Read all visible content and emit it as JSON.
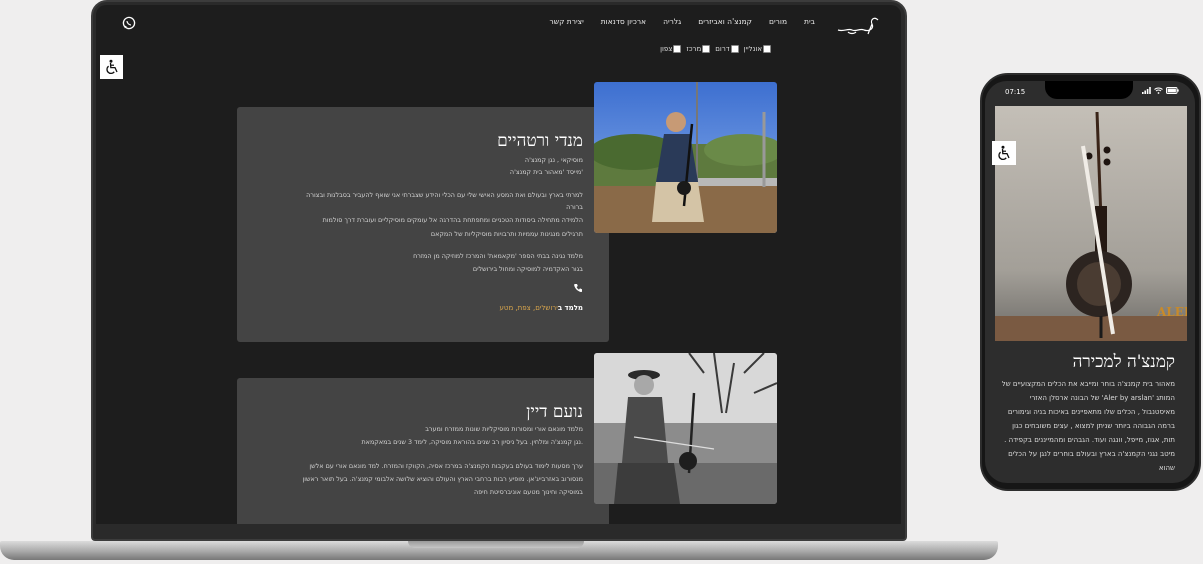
{
  "site": {
    "nav": [
      "בית",
      "מורים",
      "קמנצ'ה ואביזרים",
      "גלריה",
      "ארכיון סדנאות",
      "יצירת קשר"
    ],
    "filters": [
      "אונליין",
      "דרום",
      "מרכז",
      "צפון"
    ]
  },
  "teachers": [
    {
      "name": "מנדי ורטהיים",
      "lines": [
        "מוסיקאי  , נגן קמנצ'ה",
        "מייסד 'מאהור בית קמנצ'ה'",
        "",
        "למרתי בארץ ובעולם ואת המסע האישי שלי עם הכלי והידע שצברתי אני שואף להעביר בסבלנות ובצורה",
        "ברורה",
        "הלמידה מתחילה ביסודות הטכניים ומתפתחת בהדרגה אל עומקים מוסיקליים ועוברת דרך סולמות",
        "תרגילים מנגינות עממיות ותרבויות מוסיקליות של המקאם",
        "",
        "מלמד נגינה בבתי הספר 'מקאמאת' והמרכז למוזיקה מן המזרח",
        "בגור האקדמיה למוסיקה ומחול בירושלים"
      ],
      "location_label": "מלמד ב",
      "location_value": "ירושלים, צפת, מטע"
    },
    {
      "name": "נועם דיין",
      "lines": [
        "מלמד מונאם אורי ומסורות מוסיקליות שונות ממזרח ומערב",
        "נגן קמנצ'ה ומלחין. בעל ניסיון רב שנים בהוראת מוסיקה, לימד 3 שנים במאקמאת.",
        "",
        "ערך מסעות לימוד בעולם בעקבות הקמנצ'ה במרכז אסיה, הקווקז והמזרח. למד מונאם אורי עם אלשן",
        "מנסורוב באזרבייג'אן. מופיע רבות ברחבי הארץ והעולם והוציא שלושה אלבומי קמנצ'ה. בעל תואר ראשון",
        "במוסיקה וחינוך מטעם אוניברסיטת חיפה"
      ]
    }
  ],
  "mobile": {
    "status_time": "07:15",
    "title": "קמנצ'ה למכירה",
    "paragraph": "מאהור בית קמנצ'ה בוחר ומייבא את הכלים המקצועיים של המותג 'Aler by arslan' של הבונה ארסלן האזרי מאיסטנבול , הכלים שלו מתאפיינים באיכות בניה וגימורים ברמה הגבוהה ביותר שניתן למצוא , עצים משובחים כגון תות, אגוז, מייפל, וונגה ועוד. הגבהים ומהמייננים בקפידה . מיטב נגני הקמנצ'ה בארץ ובעולם בוחרים לנגן על הכלים שהוא",
    "brand_text": "ALER"
  },
  "icons": {
    "whatsapp": "whatsapp-icon",
    "accessibility": "wheelchair-icon",
    "phone": "phone-icon"
  }
}
